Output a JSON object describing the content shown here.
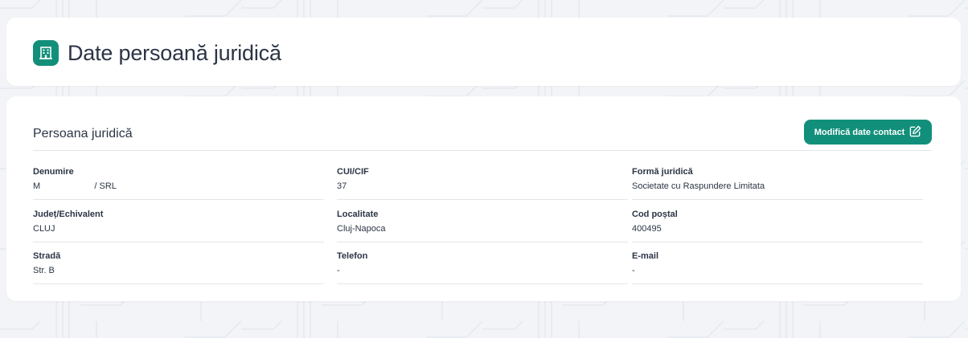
{
  "header": {
    "title": "Date persoană juridică",
    "icon": "building-icon"
  },
  "section": {
    "title": "Persoana juridică",
    "edit_button_label": "Modifică date contact",
    "edit_button_icon": "edit-icon"
  },
  "fields": {
    "denumire": {
      "label": "Denumire",
      "value": "M                      / SRL"
    },
    "cui": {
      "label": "CUI/CIF",
      "value": "37"
    },
    "forma": {
      "label": "Formă juridică",
      "value": "Societate cu Raspundere Limitata"
    },
    "judet": {
      "label": "Județ/Echivalent",
      "value": "CLUJ"
    },
    "localitate": {
      "label": "Localitate",
      "value": "Cluj-Napoca"
    },
    "cod_postal": {
      "label": "Cod poștal",
      "value": "400495"
    },
    "strada": {
      "label": "Stradă",
      "value": "Str. B"
    },
    "telefon": {
      "label": "Telefon",
      "value": "-"
    },
    "email": {
      "label": "E-mail",
      "value": "-"
    }
  },
  "colors": {
    "accent": "#128f7a",
    "background": "#f2f4f7",
    "text": "#2b3545",
    "divider": "#e3e6ea"
  }
}
